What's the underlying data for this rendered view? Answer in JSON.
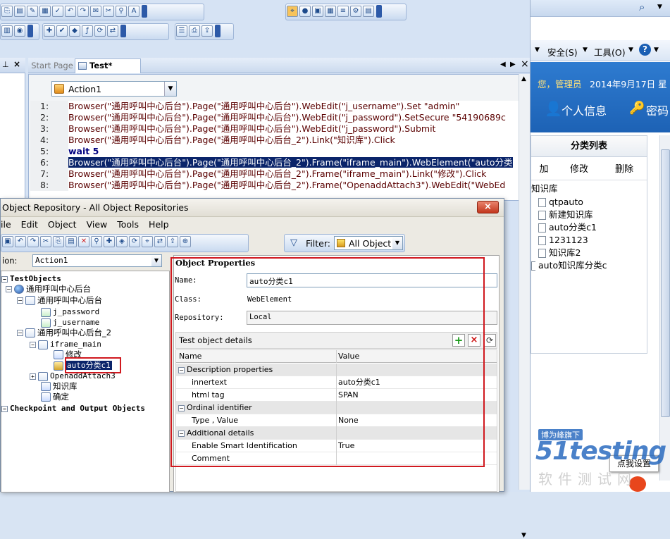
{
  "qtp": {
    "tabs": [
      {
        "label": "Start Page"
      },
      {
        "label": "Test*"
      }
    ],
    "action_dropdown": "Action1",
    "script_lines": [
      {
        "num": "1:",
        "text": "Browser(\"通用呼叫中心后台\").Page(\"通用呼叫中心后台\").WebEdit(\"j_username\").Set \"admin\""
      },
      {
        "num": "2:",
        "text": "Browser(\"通用呼叫中心后台\").Page(\"通用呼叫中心后台\").WebEdit(\"j_password\").SetSecure \"54190689c"
      },
      {
        "num": "3:",
        "text": "Browser(\"通用呼叫中心后台\").Page(\"通用呼叫中心后台\").WebEdit(\"j_password\").Submit"
      },
      {
        "num": "4:",
        "text": "Browser(\"通用呼叫中心后台\").Page(\"通用呼叫中心后台_2\").Link(\"知识库\").Click"
      },
      {
        "num": "5:",
        "text": "wait 5"
      },
      {
        "num": "6:",
        "text": "Browser(\"通用呼叫中心后台\").Page(\"通用呼叫中心后台_2\").Frame(\"iframe_main\").WebElement(\"auto分类"
      },
      {
        "num": "7:",
        "text": "Browser(\"通用呼叫中心后台\").Page(\"通用呼叫中心后台_2\").Frame(\"iframe_main\").Link(\"修改\").Click"
      },
      {
        "num": "8:",
        "text": "Browser(\"通用呼叫中心后台\").Page(\"通用呼叫中心后台_2\").Frame(\"OpenaddAttach3\").WebEdit(\"WebEd"
      }
    ]
  },
  "repo": {
    "title": "Object Repository - All Object Repositories",
    "menu": [
      "ile",
      "Edit",
      "Object",
      "View",
      "Tools",
      "Help"
    ],
    "filter_label": "Filter:",
    "filter_value": "All Object",
    "action_label": "ion:",
    "action_value": "Action1",
    "tree": {
      "root": "TestObjects",
      "browser": "通用呼叫中心后台",
      "page1": "通用呼叫中心后台",
      "edit1": "j_password",
      "edit2": "j_username",
      "page2": "通用呼叫中心后台_2",
      "frame": "iframe_main",
      "link1": "修改",
      "element": "auto分类c1",
      "frame2": "OpenaddAttach3",
      "link2": "知识库",
      "link3": "确定",
      "checkpoints": "Checkpoint and Output Objects"
    },
    "props": {
      "heading": "Object Properties",
      "name_label": "Name:",
      "name_value": "auto分类c1",
      "class_label": "Class:",
      "class_value": "WebElement",
      "repo_label": "Repository:",
      "repo_value": "Local",
      "details_title": "Test object details",
      "col_name": "Name",
      "col_value": "Value",
      "rows": [
        {
          "name": "Description properties",
          "value": "",
          "category": true
        },
        {
          "name": "innertext",
          "value": "auto分类c1",
          "category": false
        },
        {
          "name": "html tag",
          "value": "SPAN",
          "category": false
        },
        {
          "name": "Ordinal identifier",
          "value": "",
          "category": true
        },
        {
          "name": "Type , Value",
          "value": "None",
          "category": false
        },
        {
          "name": "Additional details",
          "value": "",
          "category": true
        },
        {
          "name": "Enable Smart Identification",
          "value": "True",
          "category": false
        },
        {
          "name": "Comment",
          "value": "",
          "category": false
        }
      ]
    }
  },
  "ie": {
    "menu": [
      "安全(S)",
      "工具(O)"
    ],
    "greeting": "您，管理员",
    "date": "2014年9月17日 星",
    "nav": [
      "个人信息",
      "密码"
    ],
    "panel_title": "分类列表",
    "buttons": [
      "加",
      "修改",
      "删除"
    ],
    "tree": [
      "知识库",
      "qtpauto",
      "新建知识库",
      "auto分类c1",
      "1231123",
      "知识库2",
      "auto知识库分类c"
    ],
    "popup": "点我设置"
  },
  "watermark": {
    "brand": "博为峰旗下",
    "logo": "51testing",
    "sub": "软件测试网"
  },
  "colors": {
    "selection": "#0a246a",
    "red_box": "#d0191f",
    "ie_blue": "#1a5fb4"
  }
}
